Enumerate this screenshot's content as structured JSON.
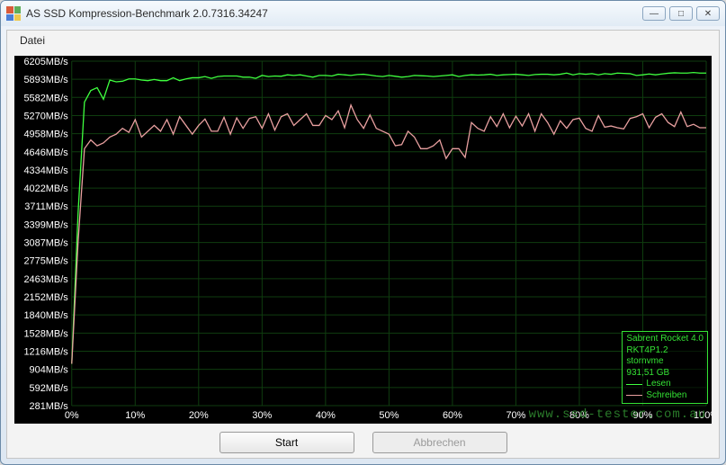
{
  "window": {
    "title": "AS SSD Kompression-Benchmark 2.0.7316.34247",
    "min": "—",
    "max": "□",
    "close": "✕"
  },
  "menu": {
    "file": "Datei"
  },
  "buttons": {
    "start": "Start",
    "cancel": "Abbrechen"
  },
  "watermark": "www.ssd-tester.com.au",
  "legend": {
    "device": "Sabrent Rocket 4.0",
    "firmware": "RKT4P1.2",
    "driver": "stornvme",
    "capacity": "931,51 GB",
    "read": "Lesen",
    "write": "Schreiben"
  },
  "chart_data": {
    "type": "line",
    "title": "",
    "xlabel": "",
    "ylabel": "",
    "x_unit": "%",
    "y_unit": "MB/s",
    "xlim": [
      0,
      100
    ],
    "ylim": [
      281,
      6205
    ],
    "x_ticks": [
      0,
      10,
      20,
      30,
      40,
      50,
      60,
      70,
      80,
      90,
      100
    ],
    "y_ticks": [
      6205,
      5893,
      5582,
      5270,
      4958,
      4646,
      4334,
      4022,
      3711,
      3399,
      3087,
      2775,
      2463,
      2152,
      1840,
      1528,
      1216,
      904,
      592,
      281
    ],
    "x": [
      0,
      1,
      2,
      3,
      4,
      5,
      6,
      7,
      8,
      9,
      10,
      11,
      12,
      13,
      14,
      15,
      16,
      17,
      18,
      19,
      20,
      21,
      22,
      23,
      24,
      25,
      26,
      27,
      28,
      29,
      30,
      31,
      32,
      33,
      34,
      35,
      36,
      37,
      38,
      39,
      40,
      41,
      42,
      43,
      44,
      45,
      46,
      47,
      48,
      49,
      50,
      51,
      52,
      53,
      54,
      55,
      56,
      57,
      58,
      59,
      60,
      61,
      62,
      63,
      64,
      65,
      66,
      67,
      68,
      69,
      70,
      71,
      72,
      73,
      74,
      75,
      76,
      77,
      78,
      79,
      80,
      81,
      82,
      83,
      84,
      85,
      86,
      87,
      88,
      89,
      90,
      91,
      92,
      93,
      94,
      95,
      96,
      97,
      98,
      99,
      100
    ],
    "series": [
      {
        "name": "Lesen",
        "color": "#3fff3f",
        "values": [
          1000,
          3600,
          5500,
          5700,
          5750,
          5550,
          5880,
          5850,
          5860,
          5900,
          5900,
          5880,
          5870,
          5890,
          5870,
          5870,
          5920,
          5870,
          5900,
          5920,
          5920,
          5940,
          5910,
          5940,
          5950,
          5950,
          5950,
          5930,
          5930,
          5910,
          5960,
          5940,
          5950,
          5945,
          5970,
          5960,
          5970,
          5950,
          5930,
          5960,
          5960,
          5950,
          5980,
          5970,
          5960,
          5975,
          5980,
          5965,
          5950,
          5940,
          5960,
          5945,
          5930,
          5940,
          5960,
          5955,
          5950,
          5940,
          5950,
          5960,
          5970,
          5940,
          5960,
          5970,
          5965,
          5970,
          5980,
          5960,
          5970,
          5975,
          5980,
          5970,
          5960,
          5975,
          5980,
          5980,
          5970,
          5980,
          6000,
          5970,
          5990,
          5980,
          5990,
          5970,
          5990,
          5980,
          6000,
          5995,
          5990,
          5960,
          5970,
          5985,
          5970,
          5985,
          5997,
          6005,
          6000,
          6000,
          6010,
          6000,
          6000
        ]
      },
      {
        "name": "Schreiben",
        "color": "#e9a0a0",
        "values": [
          1000,
          3100,
          4700,
          4850,
          4750,
          4800,
          4900,
          4950,
          5050,
          4980,
          5200,
          4900,
          5000,
          5100,
          5000,
          5200,
          4950,
          5250,
          5100,
          4950,
          5100,
          5210,
          5000,
          5000,
          5240,
          4950,
          5230,
          5050,
          5220,
          5250,
          5050,
          5300,
          5020,
          5250,
          5300,
          5100,
          5200,
          5300,
          5100,
          5100,
          5270,
          5200,
          5350,
          5060,
          5450,
          5200,
          5050,
          5280,
          5050,
          5000,
          4950,
          4750,
          4770,
          5000,
          4900,
          4700,
          4700,
          4750,
          4850,
          4530,
          4700,
          4700,
          4550,
          5150,
          5050,
          5000,
          5250,
          5080,
          5300,
          5060,
          5260,
          5090,
          5300,
          5000,
          5300,
          5150,
          4950,
          5180,
          5050,
          5200,
          5225,
          5050,
          5000,
          5270,
          5070,
          5090,
          5060,
          5040,
          5220,
          5250,
          5300,
          5060,
          5240,
          5300,
          5150,
          5080,
          5330,
          5080,
          5120,
          5060,
          5060
        ]
      }
    ]
  }
}
